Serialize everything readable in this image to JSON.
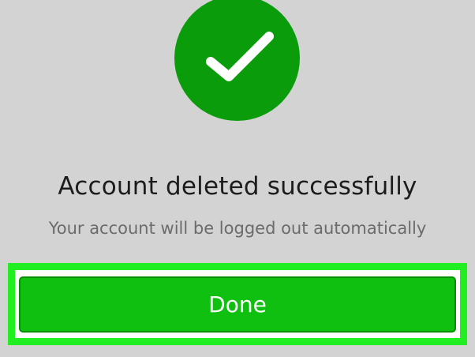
{
  "status": {
    "icon": "checkmark-icon",
    "icon_color": "#0a9c0a",
    "title": "Account deleted successfully",
    "subtitle": "Your account will be logged out automatically"
  },
  "actions": {
    "done_label": "Done",
    "button_color": "#10c010",
    "highlight_color": "#22ef22"
  }
}
